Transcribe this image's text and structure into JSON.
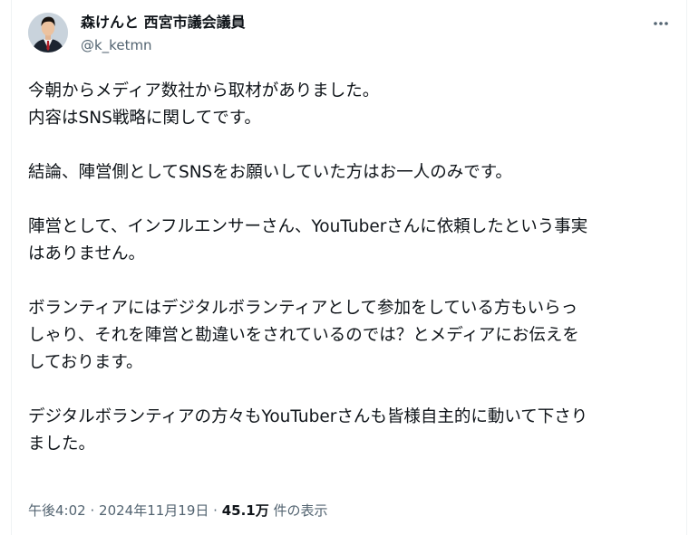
{
  "author": {
    "display_name": "森けんと 西宮市議会議員",
    "handle": "@k_ketmn"
  },
  "icons": {
    "more": "more-horizontal-icon",
    "avatar": "profile-photo"
  },
  "tweet": {
    "lines": [
      "今朝からメディア数社から取材がありました。",
      "内容はSNS戦略に関してです。",
      "",
      "結論、陣営側としてSNSをお願いしていた方はお一人のみです。",
      "",
      "陣営として、インフルエンサーさん、YouTuberさんに依頼したという事実",
      "はありません。",
      "",
      "ボランティアにはデジタルボランティアとして参加をしている方もいらっ",
      "しゃり、それを陣営と勘違いをされているのでは？とメディアにお伝えを",
      "しております。",
      "",
      "デジタルボランティアの方々もYouTuberさんも皆様自主的に動いて下さり",
      "ました。"
    ]
  },
  "meta": {
    "time": "午後4:02",
    "separator": "·",
    "date": "2024年11月19日",
    "views_count": "45.1万",
    "views_label": "件の表示"
  },
  "colors": {
    "text_primary": "#0f1419",
    "text_secondary": "#536471",
    "border": "#eff3f4"
  }
}
